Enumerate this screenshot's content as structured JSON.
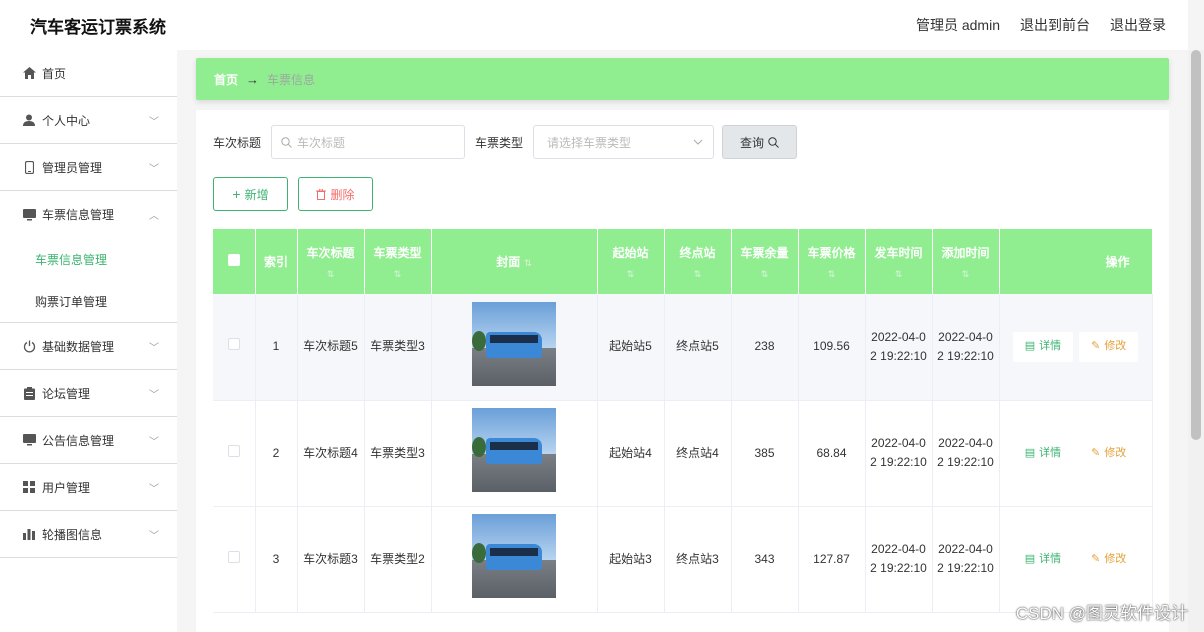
{
  "header": {
    "title": "汽车客运订票系统",
    "admin_label": "管理员 admin",
    "front_link": "退出到前台",
    "logout_link": "退出登录"
  },
  "sidebar": {
    "home": "首页",
    "personal": "个人中心",
    "admin_mgmt": "管理员管理",
    "ticket_info_mgmt": "车票信息管理",
    "sub_ticket_info": "车票信息管理",
    "sub_order": "购票订单管理",
    "basic_data": "基础数据管理",
    "forum": "论坛管理",
    "notice": "公告信息管理",
    "user": "用户管理",
    "carousel": "轮播图信息"
  },
  "breadcrumb": {
    "home": "首页",
    "arrow": "→",
    "current": "车票信息"
  },
  "search": {
    "title_label": "车次标题",
    "title_placeholder": "车次标题",
    "type_label": "车票类型",
    "type_placeholder": "请选择车票类型",
    "query_label": "查询"
  },
  "actions": {
    "add_label": "新增",
    "delete_label": "删除"
  },
  "table": {
    "headers": {
      "index": "索引",
      "title": "车次标题",
      "type": "车票类型",
      "cover": "封面",
      "start": "起始站",
      "end": "终点站",
      "remaining": "车票余量",
      "price": "车票价格",
      "depart": "发车时间",
      "added": "添加时间",
      "ops": "操作"
    },
    "detail_label": "详情",
    "edit_label": "修改",
    "rows": [
      {
        "index": "1",
        "title": "车次标题5",
        "type": "车票类型3",
        "start": "起始站5",
        "end": "终点站5",
        "remaining": "238",
        "price": "109.56",
        "depart": "2022-04-02 19:22:10",
        "added": "2022-04-02 19:22:10"
      },
      {
        "index": "2",
        "title": "车次标题4",
        "type": "车票类型3",
        "start": "起始站4",
        "end": "终点站4",
        "remaining": "385",
        "price": "68.84",
        "depart": "2022-04-02 19:22:10",
        "added": "2022-04-02 19:22:10"
      },
      {
        "index": "3",
        "title": "车次标题3",
        "type": "车票类型2",
        "start": "起始站3",
        "end": "终点站3",
        "remaining": "343",
        "price": "127.87",
        "depart": "2022-04-02 19:22:10",
        "added": "2022-04-02 19:22:10"
      }
    ]
  },
  "watermark": "CSDN @图灵软件设计",
  "colors": {
    "accent": "#90ee90",
    "active_text": "#3cb371",
    "delete_text": "#f56c6c",
    "edit_text": "#e6a23c"
  }
}
